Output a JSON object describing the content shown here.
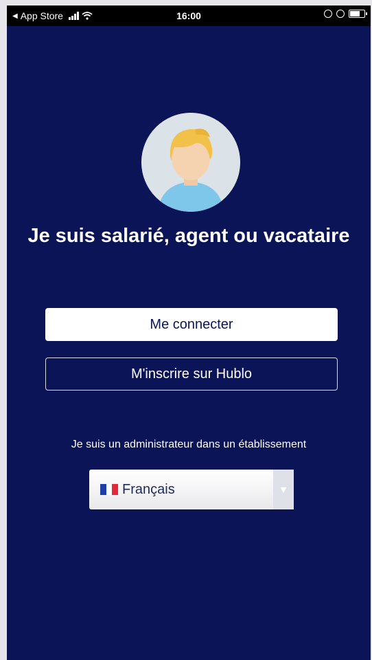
{
  "status_bar": {
    "back_label": "App Store",
    "time": "16:00"
  },
  "title": "Je suis salarié, agent ou vacataire",
  "buttons": {
    "login": "Me connecter",
    "register": "M'inscrire sur Hublo"
  },
  "admin_link": "Je suis un administrateur dans un établissement",
  "language": {
    "selected": "Français",
    "flag_icon": "france-flag-icon"
  },
  "colors": {
    "background": "#0b1457",
    "primary_button": "#ffffff",
    "text": "#ffffff"
  }
}
